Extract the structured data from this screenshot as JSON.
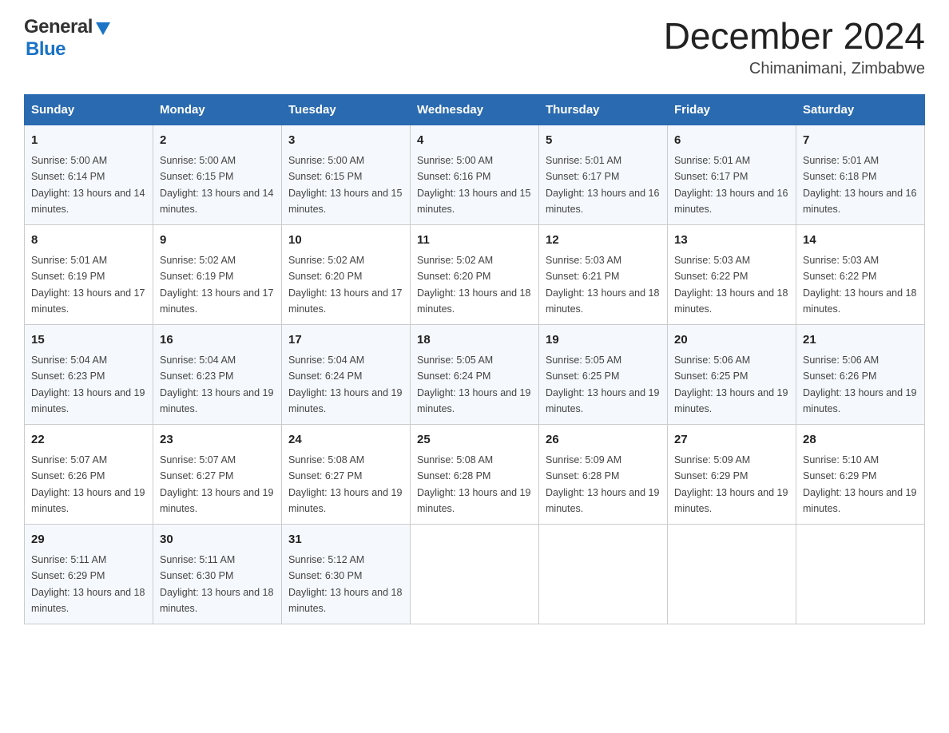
{
  "header": {
    "logo_general": "General",
    "logo_blue": "Blue",
    "title": "December 2024",
    "location": "Chimanimani, Zimbabwe"
  },
  "days_of_week": [
    "Sunday",
    "Monday",
    "Tuesday",
    "Wednesday",
    "Thursday",
    "Friday",
    "Saturday"
  ],
  "weeks": [
    [
      {
        "day": "1",
        "sunrise": "5:00 AM",
        "sunset": "6:14 PM",
        "daylight": "13 hours and 14 minutes."
      },
      {
        "day": "2",
        "sunrise": "5:00 AM",
        "sunset": "6:15 PM",
        "daylight": "13 hours and 14 minutes."
      },
      {
        "day": "3",
        "sunrise": "5:00 AM",
        "sunset": "6:15 PM",
        "daylight": "13 hours and 15 minutes."
      },
      {
        "day": "4",
        "sunrise": "5:00 AM",
        "sunset": "6:16 PM",
        "daylight": "13 hours and 15 minutes."
      },
      {
        "day": "5",
        "sunrise": "5:01 AM",
        "sunset": "6:17 PM",
        "daylight": "13 hours and 16 minutes."
      },
      {
        "day": "6",
        "sunrise": "5:01 AM",
        "sunset": "6:17 PM",
        "daylight": "13 hours and 16 minutes."
      },
      {
        "day": "7",
        "sunrise": "5:01 AM",
        "sunset": "6:18 PM",
        "daylight": "13 hours and 16 minutes."
      }
    ],
    [
      {
        "day": "8",
        "sunrise": "5:01 AM",
        "sunset": "6:19 PM",
        "daylight": "13 hours and 17 minutes."
      },
      {
        "day": "9",
        "sunrise": "5:02 AM",
        "sunset": "6:19 PM",
        "daylight": "13 hours and 17 minutes."
      },
      {
        "day": "10",
        "sunrise": "5:02 AM",
        "sunset": "6:20 PM",
        "daylight": "13 hours and 17 minutes."
      },
      {
        "day": "11",
        "sunrise": "5:02 AM",
        "sunset": "6:20 PM",
        "daylight": "13 hours and 18 minutes."
      },
      {
        "day": "12",
        "sunrise": "5:03 AM",
        "sunset": "6:21 PM",
        "daylight": "13 hours and 18 minutes."
      },
      {
        "day": "13",
        "sunrise": "5:03 AM",
        "sunset": "6:22 PM",
        "daylight": "13 hours and 18 minutes."
      },
      {
        "day": "14",
        "sunrise": "5:03 AM",
        "sunset": "6:22 PM",
        "daylight": "13 hours and 18 minutes."
      }
    ],
    [
      {
        "day": "15",
        "sunrise": "5:04 AM",
        "sunset": "6:23 PM",
        "daylight": "13 hours and 19 minutes."
      },
      {
        "day": "16",
        "sunrise": "5:04 AM",
        "sunset": "6:23 PM",
        "daylight": "13 hours and 19 minutes."
      },
      {
        "day": "17",
        "sunrise": "5:04 AM",
        "sunset": "6:24 PM",
        "daylight": "13 hours and 19 minutes."
      },
      {
        "day": "18",
        "sunrise": "5:05 AM",
        "sunset": "6:24 PM",
        "daylight": "13 hours and 19 minutes."
      },
      {
        "day": "19",
        "sunrise": "5:05 AM",
        "sunset": "6:25 PM",
        "daylight": "13 hours and 19 minutes."
      },
      {
        "day": "20",
        "sunrise": "5:06 AM",
        "sunset": "6:25 PM",
        "daylight": "13 hours and 19 minutes."
      },
      {
        "day": "21",
        "sunrise": "5:06 AM",
        "sunset": "6:26 PM",
        "daylight": "13 hours and 19 minutes."
      }
    ],
    [
      {
        "day": "22",
        "sunrise": "5:07 AM",
        "sunset": "6:26 PM",
        "daylight": "13 hours and 19 minutes."
      },
      {
        "day": "23",
        "sunrise": "5:07 AM",
        "sunset": "6:27 PM",
        "daylight": "13 hours and 19 minutes."
      },
      {
        "day": "24",
        "sunrise": "5:08 AM",
        "sunset": "6:27 PM",
        "daylight": "13 hours and 19 minutes."
      },
      {
        "day": "25",
        "sunrise": "5:08 AM",
        "sunset": "6:28 PM",
        "daylight": "13 hours and 19 minutes."
      },
      {
        "day": "26",
        "sunrise": "5:09 AM",
        "sunset": "6:28 PM",
        "daylight": "13 hours and 19 minutes."
      },
      {
        "day": "27",
        "sunrise": "5:09 AM",
        "sunset": "6:29 PM",
        "daylight": "13 hours and 19 minutes."
      },
      {
        "day": "28",
        "sunrise": "5:10 AM",
        "sunset": "6:29 PM",
        "daylight": "13 hours and 19 minutes."
      }
    ],
    [
      {
        "day": "29",
        "sunrise": "5:11 AM",
        "sunset": "6:29 PM",
        "daylight": "13 hours and 18 minutes."
      },
      {
        "day": "30",
        "sunrise": "5:11 AM",
        "sunset": "6:30 PM",
        "daylight": "13 hours and 18 minutes."
      },
      {
        "day": "31",
        "sunrise": "5:12 AM",
        "sunset": "6:30 PM",
        "daylight": "13 hours and 18 minutes."
      },
      null,
      null,
      null,
      null
    ]
  ]
}
